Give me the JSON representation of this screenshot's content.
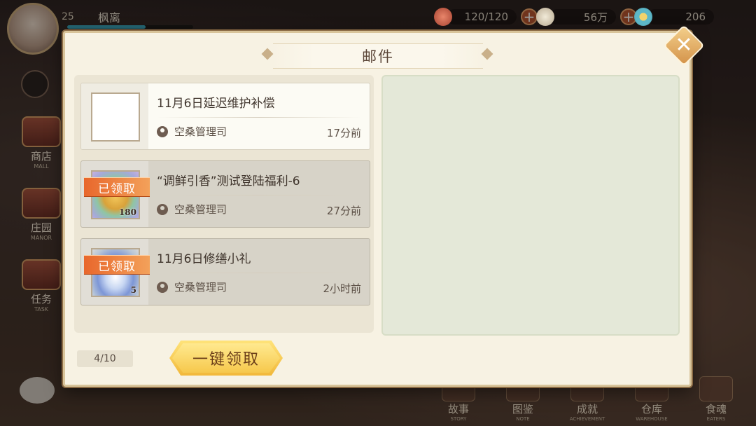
{
  "hud": {
    "player": {
      "level": "25",
      "name": "枫离",
      "exp_fraction": 0.62
    },
    "resources": [
      {
        "icon": "food-bowl-icon",
        "value": "120/120"
      },
      {
        "icon": "feather-icon",
        "value": "56万"
      },
      {
        "icon": "jade-coin-icon",
        "value": "206"
      }
    ],
    "side_menu": [
      {
        "label": "商店",
        "sub": "MALL"
      },
      {
        "label": "庄园",
        "sub": "MANOR"
      },
      {
        "label": "任务",
        "sub": "TASK"
      }
    ],
    "bottom_nav": [
      {
        "label": "故事",
        "sub": "STORY"
      },
      {
        "label": "图鉴",
        "sub": "NOTE"
      },
      {
        "label": "成就",
        "sub": "ACHIEVEMENT"
      },
      {
        "label": "仓库",
        "sub": "WAREHOUSE"
      },
      {
        "label": "食魂",
        "sub": "EATERS"
      }
    ]
  },
  "mail_dialog": {
    "title": "邮件",
    "close_label": "✕",
    "count": "4/10",
    "claim_all_label": "一键领取",
    "mails": [
      {
        "title": "11月6日延迟维护补偿",
        "sender": "空桑管理司",
        "time": "17分前",
        "claimed": false,
        "claimed_label": "",
        "qty": ""
      },
      {
        "title": "“调鲜引香”测试登陆福利-6",
        "sender": "空桑管理司",
        "time": "27分前",
        "claimed": true,
        "claimed_label": "已领取",
        "qty": "180"
      },
      {
        "title": "11月6日修缮小礼",
        "sender": "空桑管理司",
        "time": "2小时前",
        "claimed": true,
        "claimed_label": "已领取",
        "qty": "5"
      }
    ]
  },
  "colors": {
    "dialog_bg": "#f7f2e3",
    "claimed_tag": "#e8672c",
    "claim_button": "#f6c84c",
    "detail_panel": "#e4e8d8"
  }
}
